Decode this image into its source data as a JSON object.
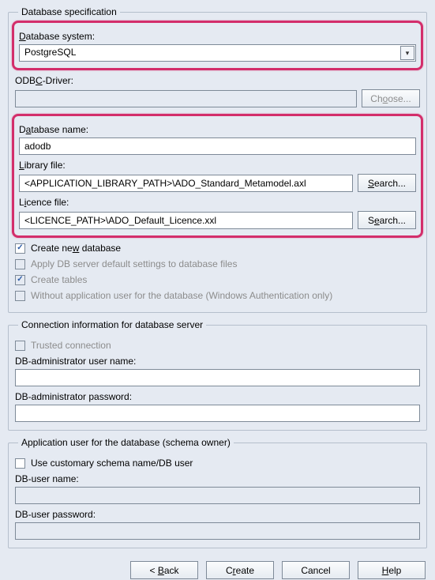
{
  "spec": {
    "legend": "Database specification",
    "system_label_pre": "",
    "system_label": "Database system:",
    "system_value": "PostgreSQL",
    "odbc_label": "ODBC-Driver:",
    "odbc_value": "",
    "choose_btn": "Choose...",
    "dbname_label": "Database name:",
    "dbname_value": "adodb",
    "libfile_label": "Library file:",
    "libfile_value": "<APPLICATION_LIBRARY_PATH>\\ADO_Standard_Metamodel.axl",
    "licfile_label": "Licence file:",
    "licfile_value": "<LICENCE_PATH>\\ADO_Default_Licence.xxl",
    "search_btn": "Search...",
    "chk_create_new": "Create new database",
    "chk_apply_default": "Apply DB server default settings to database files",
    "chk_create_tables": "Create tables",
    "chk_no_app_user": "Without application user for the database (Windows Authentication only)"
  },
  "conn": {
    "legend": "Connection information for database server",
    "chk_trusted": "Trusted connection",
    "admin_user_label": "DB-administrator user name:",
    "admin_user_value": "",
    "admin_pw_label": "DB-administrator password:",
    "admin_pw_value": ""
  },
  "appuser": {
    "legend": "Application user for the database (schema owner)",
    "chk_customary": "Use customary schema name/DB user",
    "dbuser_label": "DB-user name:",
    "dbuser_value": "",
    "dbpw_label": "DB-user password:",
    "dbpw_value": ""
  },
  "footer": {
    "back": "< Back",
    "create": "Create",
    "cancel": "Cancel",
    "help": "Help"
  }
}
